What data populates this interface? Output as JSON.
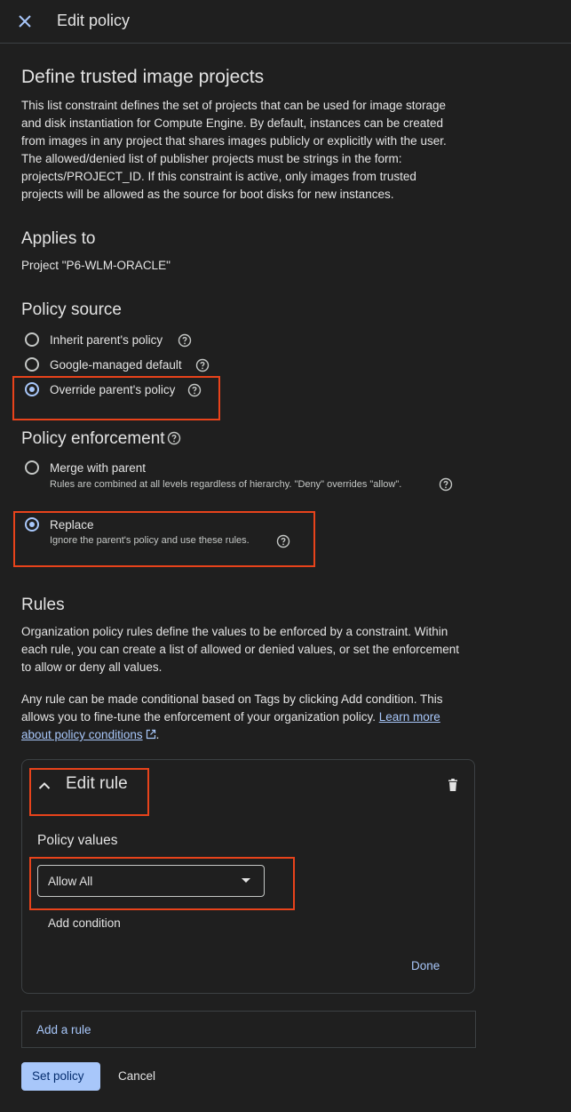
{
  "header": {
    "title": "Edit policy",
    "close_icon": "close-icon"
  },
  "constraint": {
    "title": "Define trusted image projects",
    "description_lines": [
      "This list constraint defines the set of projects that can be used for image storage",
      "and disk instantiation for Compute Engine. By default, instances can be created",
      "from images in any project that shares images publicly or explicitly with the user.",
      "The allowed/denied list of publisher projects must be strings in the form:",
      "projects/PROJECT_ID. If this constraint is active, only images from trusted",
      "projects will be allowed as the source for boot disks for new instances."
    ]
  },
  "applies_to": {
    "heading": "Applies to",
    "value": "Project \"P6-WLM-ORACLE\""
  },
  "policy_source": {
    "heading": "Policy source",
    "options": [
      {
        "label": "Inherit parent's policy",
        "selected": false
      },
      {
        "label": "Google-managed default",
        "selected": false
      },
      {
        "label": "Override parent's policy",
        "selected": true
      }
    ]
  },
  "policy_enforcement": {
    "heading": "Policy enforcement",
    "options": [
      {
        "label": "Merge with parent",
        "description": "Rules are combined at all levels regardless of hierarchy. \"Deny\" overrides \"allow\".",
        "selected": false
      },
      {
        "label": "Replace",
        "description": "Ignore the parent's policy and use these rules.",
        "selected": true
      }
    ]
  },
  "rules": {
    "heading": "Rules",
    "description_lines": [
      "Organization policy rules define the values to be enforced by a constraint. Within",
      "each rule, you can create a list of allowed or denied values, or set the enforcement",
      "to allow or deny all values."
    ],
    "conditional_line1": "Any rule can be made conditional based on Tags by clicking Add condition. This",
    "conditional_line2_prefix": "allows you to fine-tune the enforcement of your organization policy. ",
    "learn_more_part1": "Learn more",
    "learn_more_part2": "about policy conditions",
    "period": ".",
    "edit_rule": {
      "title": "Edit rule",
      "policy_values_label": "Policy values",
      "policy_values_selected": "Allow All",
      "add_condition": "Add condition",
      "done": "Done"
    },
    "add_rule": "Add a rule"
  },
  "footer": {
    "set_policy": "Set policy",
    "cancel": "Cancel"
  },
  "colors": {
    "background": "#1f1f1f",
    "accent": "#a8c7fa",
    "highlight": "#e8431b",
    "text": "#e3e3e3"
  }
}
